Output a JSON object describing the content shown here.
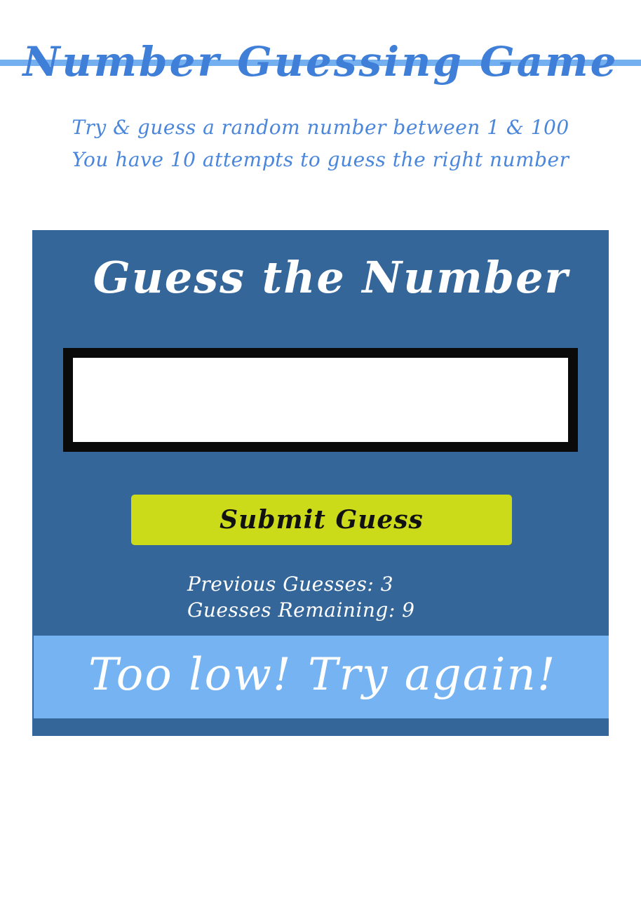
{
  "header": {
    "title": "Number Guessing Game",
    "subtitle_line1": "Try & guess a random number between 1 & 100",
    "subtitle_line2": "You have 10 attempts to guess the right number"
  },
  "game": {
    "heading": "Guess the Number",
    "input_value": "",
    "submit_label": "Submit Guess",
    "previous_guesses_text": "Previous Guesses: 3",
    "remaining_text": "Guesses Remaining: 9",
    "feedback": "Too low! Try again!"
  },
  "colors": {
    "title_blue": "#3f7fd8",
    "title_underline": "#74b0f0",
    "panel_bg": "#356699",
    "button_bg": "#cbdb1a",
    "feedback_bg": "#76b3f2"
  }
}
